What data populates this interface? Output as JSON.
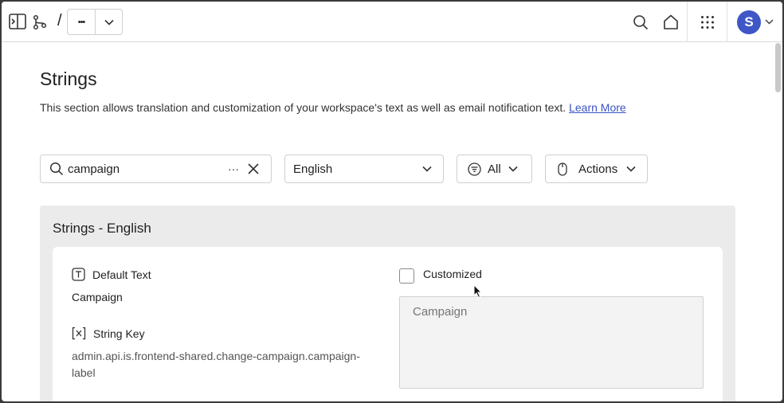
{
  "topbar": {
    "slash": "/",
    "more_label": "•••",
    "avatar_initial": "S"
  },
  "page": {
    "title": "Strings",
    "description": "This section allows translation and customization of your workspace's text as well as email notification text.",
    "learn_more": "Learn More"
  },
  "filters": {
    "search_value": "campaign",
    "search_more": "···",
    "language": "English",
    "filter_label": "All",
    "actions_label": "Actions"
  },
  "panel": {
    "title": "Strings - English",
    "default_text_label": "Default Text",
    "default_text_value": "Campaign",
    "string_key_label": "String Key",
    "string_key_value": "admin.api.is.frontend-shared.change-campaign.campaign-label",
    "customized_label": "Customized",
    "custom_placeholder": "Campaign"
  },
  "colors": {
    "accent": "#3b52c4",
    "avatar_bg": "#3e56c6",
    "panel_bg": "#ebebeb"
  }
}
